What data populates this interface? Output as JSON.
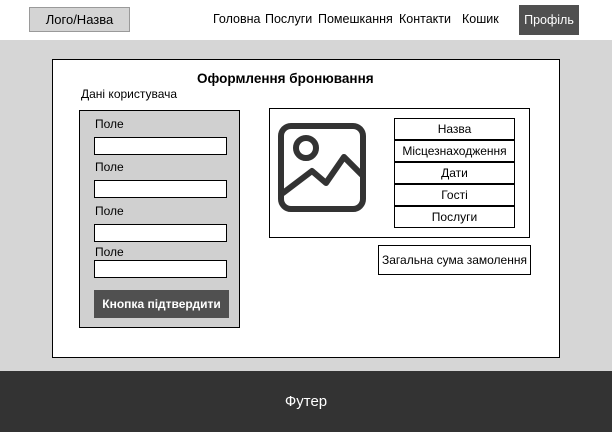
{
  "header": {
    "logo": "Лого/Назва",
    "nav": [
      "Головна",
      "Послуги",
      "Помешкання",
      "Контакти",
      "Кошик"
    ],
    "profile": "Профіль"
  },
  "main": {
    "title": "Оформлення бронювання",
    "subtitle": "Дані користувача"
  },
  "form": {
    "fields": [
      {
        "label": "Поле",
        "value": ""
      },
      {
        "label": "Поле",
        "value": ""
      },
      {
        "label": "Поле",
        "value": ""
      },
      {
        "label": "Поле",
        "value": ""
      }
    ],
    "confirm_button": "Кнопка підтвердити"
  },
  "booking": {
    "image_icon": "image-placeholder-icon",
    "details": [
      "Назва",
      "Місцезнаходження",
      "Дати",
      "Гості",
      "Послуги"
    ]
  },
  "total": "Загальна сума замолення",
  "footer": "Футер",
  "colors": {
    "header_bg": "#ffffff",
    "body_bg": "#d6d6d6",
    "form_bg": "#d0d0d0",
    "dark_button": "#505050",
    "footer_bg": "#333333"
  }
}
